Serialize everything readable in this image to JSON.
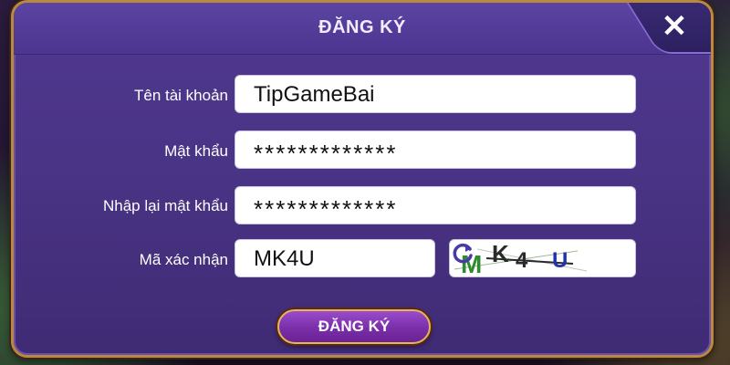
{
  "dialog": {
    "title": "ĐĂNG KÝ",
    "close_label": "✕"
  },
  "form": {
    "username": {
      "label": "Tên tài khoản",
      "value": "TipGameBai"
    },
    "password": {
      "label": "Mật khẩu",
      "value": "*************"
    },
    "confirm_password": {
      "label": "Nhập lại mật khẩu",
      "value": "*************"
    },
    "captcha": {
      "label": "Mã xác nhận",
      "value": "MK4U",
      "image_text": "MK4U"
    }
  },
  "submit_label": "ĐĂNG KÝ",
  "icons": {
    "close": "close-icon",
    "refresh": "refresh-icon"
  },
  "colors": {
    "dialog_bg": "#4a3486",
    "border": "#b98a3e",
    "button_bg": "#7a2ea8",
    "text": "#ffffff"
  }
}
